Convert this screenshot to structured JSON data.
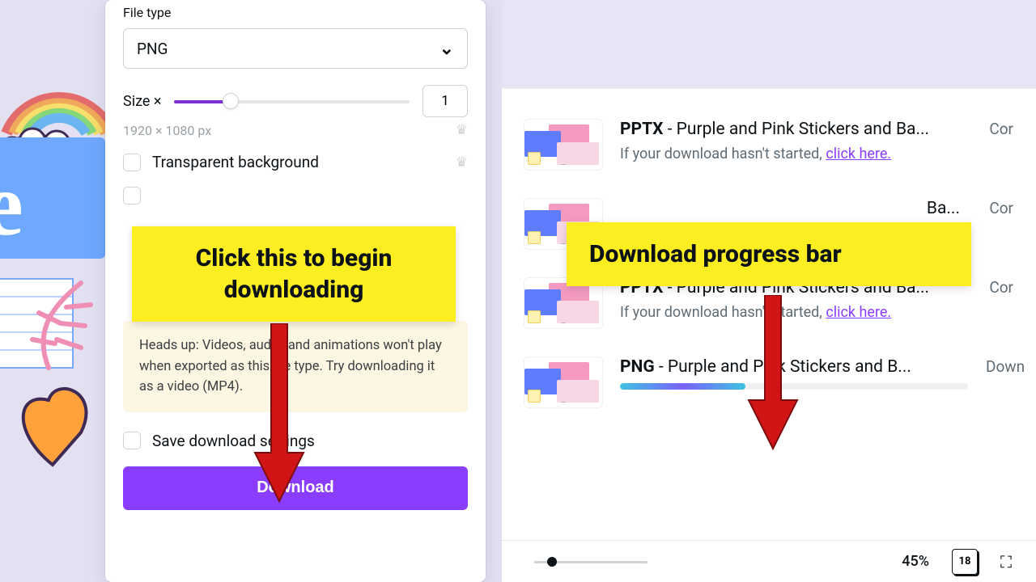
{
  "leftPanel": {
    "fileTypeLabel": "File type",
    "fileTypeValue": "PNG",
    "sizeLabel": "Size ×",
    "sizeValue": "1",
    "dimensions": "1920 × 1080 px",
    "transparentBg": "Transparent background",
    "warning": "Heads up: Videos, audio, and animations won't play when exported as this file type. Try downloading it as a video (MP4).",
    "saveSettings": "Save download settings",
    "downloadBtn": "Download"
  },
  "callouts": {
    "left": "Click this to begin downloading",
    "right": "Download progress bar"
  },
  "downloads": {
    "subPrefix": "If your download hasn't started, ",
    "clickHere": "click here.",
    "items": [
      {
        "fmt": "PPTX",
        "title": " - Purple and Pink Stickers and Ba...",
        "status": "Cor"
      },
      {
        "fmt": "",
        "title": "Ba...",
        "status": "Cor"
      },
      {
        "fmt": "PPTX",
        "title": " - Purple and Pink Stickers and Ba...",
        "status": "Cor"
      },
      {
        "fmt": "PNG",
        "title": " - Purple and Pink Stickers and B...",
        "status": "Down"
      }
    ]
  },
  "bottomBar": {
    "zoom": "45%",
    "pageCount": "18"
  }
}
